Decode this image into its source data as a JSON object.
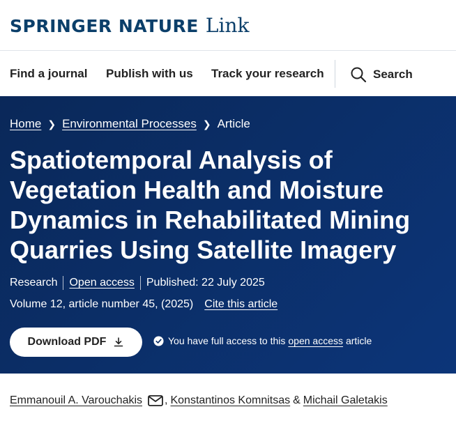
{
  "brand": {
    "name": "SPRINGER NATURE",
    "product": "Link"
  },
  "nav": {
    "items": [
      "Find a journal",
      "Publish with us",
      "Track your research"
    ],
    "search_label": "Search"
  },
  "breadcrumb": {
    "home": "Home",
    "journal": "Environmental Processes",
    "current": "Article"
  },
  "article": {
    "title": "Spatiotemporal Analysis of Vegetation Health and Moisture Dynamics in Rehabilitated Mining Quarries Using Satellite Imagery",
    "type": "Research",
    "access": "Open access",
    "published": "Published: 22 July 2025",
    "volume": "Volume 12, article number 45, (2025)",
    "cite_label": "Cite this article"
  },
  "download": {
    "label": "Download PDF"
  },
  "access_note": {
    "prefix": "You have full access to this",
    "link": "open access",
    "suffix": "article"
  },
  "authors": {
    "first": "Emmanouil A. Varouchakis",
    "second": "Konstantinos Komnitsas",
    "third": "Michail Galetakis",
    "comma": ",",
    "amp": "&"
  },
  "colors": {
    "brand_navy": "#0b3f6a",
    "hero_bg": "#0b2e67",
    "text": "#222222"
  },
  "icons": [
    "search-icon",
    "chevron-right-icon",
    "download-icon",
    "check-circle-icon",
    "mail-icon"
  ]
}
